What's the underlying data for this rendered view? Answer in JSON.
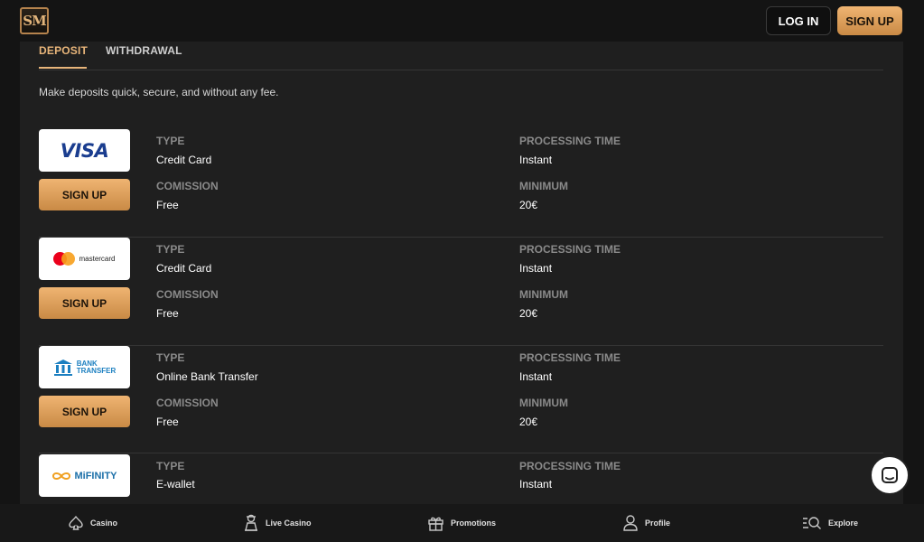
{
  "header": {
    "logo_text": "SM",
    "login_label": "LOG IN",
    "signup_label": "SIGN UP"
  },
  "tabs": {
    "deposit": "DEPOSIT",
    "withdrawal": "WITHDRAWAL"
  },
  "intro": "Make deposits quick, secure, and without any fee.",
  "labels": {
    "type": "TYPE",
    "processing_time": "PROCESSING TIME",
    "commission": "COMISSION",
    "minimum": "MINIMUM"
  },
  "methods": [
    {
      "brand": "VISA",
      "signup_label": "SIGN UP",
      "type": "Credit Card",
      "processing_time": "Instant",
      "commission": "Free",
      "minimum": "20€"
    },
    {
      "brand": "mastercard",
      "signup_label": "SIGN UP",
      "type": "Credit Card",
      "processing_time": "Instant",
      "commission": "Free",
      "minimum": "20€"
    },
    {
      "brand": "BANK TRANSFER",
      "brand_line1": "BANK",
      "brand_line2": "TRANSFER",
      "signup_label": "SIGN UP",
      "type": "Online Bank Transfer",
      "processing_time": "Instant",
      "commission": "Free",
      "minimum": "20€"
    },
    {
      "brand": "MiFINITY",
      "type": "E-wallet",
      "processing_time": "Instant"
    }
  ],
  "bottom_nav": [
    {
      "label": "Casino",
      "icon": "spade-icon"
    },
    {
      "label": "Live Casino",
      "icon": "dealer-icon"
    },
    {
      "label": "Promotions",
      "icon": "gift-icon"
    },
    {
      "label": "Profile",
      "icon": "user-icon"
    },
    {
      "label": "Explore",
      "icon": "search-list-icon"
    }
  ],
  "colors": {
    "accent": "#e8b57a",
    "button_gradient_top": "#efb472",
    "button_gradient_bottom": "#c98a45",
    "background": "#141414",
    "panel": "#1f1f1f"
  }
}
